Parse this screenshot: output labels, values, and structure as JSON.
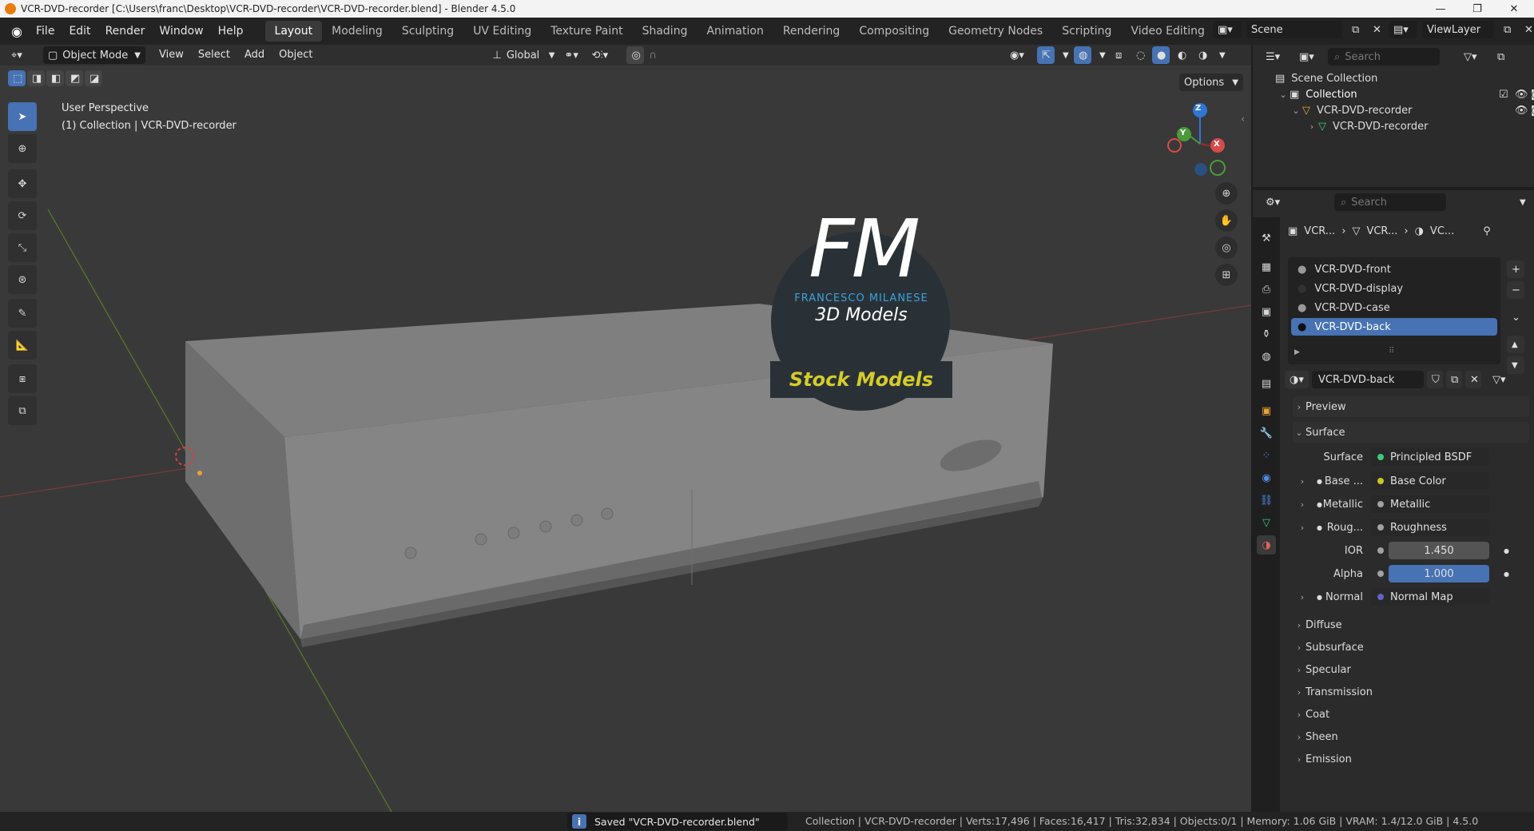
{
  "titlebar": {
    "title": "VCR-DVD-recorder [C:\\Users\\franc\\Desktop\\VCR-DVD-recorder\\VCR-DVD-recorder.blend] - Blender 4.5.0",
    "min": "—",
    "max": "❐",
    "close": "✕"
  },
  "menus": [
    "File",
    "Edit",
    "Render",
    "Window",
    "Help"
  ],
  "workspaces": [
    "Layout",
    "Modeling",
    "Sculpting",
    "UV Editing",
    "Texture Paint",
    "Shading",
    "Animation",
    "Rendering",
    "Compositing",
    "Geometry Nodes",
    "Scripting",
    "Video Editing"
  ],
  "workspace_add": "+",
  "scene": {
    "label": "Scene",
    "viewlayer": "ViewLayer"
  },
  "vp_header": {
    "mode": "Object Mode",
    "menus": [
      "View",
      "Select",
      "Add",
      "Object"
    ],
    "orientation": "Global",
    "options": "Options"
  },
  "viewport": {
    "perspective": "User Perspective",
    "collection_line": "(1) Collection | VCR-DVD-recorder"
  },
  "watermark": {
    "fm": "FM",
    "name": "FRANCESCO MILANESE",
    "sub": "3D Models",
    "banner": "Stock Models"
  },
  "gizmo": {
    "z": "Z",
    "y": "Y",
    "x": "X"
  },
  "outliner": {
    "search_placeholder": "Search",
    "scene_collection": "Scene Collection",
    "collection": "Collection",
    "object": "VCR-DVD-recorder",
    "mesh": "VCR-DVD-recorder"
  },
  "props": {
    "search_placeholder": "Search",
    "breadcrumb": [
      "VCR...",
      "VCR...",
      "VC..."
    ],
    "materials": [
      "VCR-DVD-front",
      "VCR-DVD-display",
      "VCR-DVD-case",
      "VCR-DVD-back"
    ],
    "selected_material": "VCR-DVD-back",
    "material_name": "VCR-DVD-back",
    "panels": {
      "preview": "Preview",
      "surface": "Surface"
    },
    "surface": {
      "label": "Surface",
      "value": "Principled BSDF"
    },
    "inputs": [
      {
        "label": "Base ...",
        "value": "Base Color",
        "dot": "#c7c729",
        "expand": true
      },
      {
        "label": "Metallic",
        "value": "Metallic",
        "dot": "#a1a1a1",
        "expand": true
      },
      {
        "label": "Roug...",
        "value": "Roughness",
        "dot": "#a1a1a1",
        "expand": true
      },
      {
        "label": "IOR",
        "value": "1.450",
        "dot": "#a1a1a1",
        "expand": false
      },
      {
        "label": "Alpha",
        "value": "1.000",
        "dot": "#a1a1a1",
        "expand": false
      },
      {
        "label": "Normal",
        "value": "Normal Map",
        "dot": "#6363c7",
        "expand": true
      }
    ],
    "subpanels": [
      "Diffuse",
      "Subsurface",
      "Specular",
      "Transmission",
      "Coat",
      "Sheen",
      "Emission"
    ]
  },
  "status": {
    "saved": "Saved \"VCR-DVD-recorder.blend\"",
    "stats": "Collection | VCR-DVD-recorder | Verts:17,496 | Faces:16,417 | Tris:32,834 | Objects:0/1 | Memory: 1.06 GiB | VRAM: 1.4/12.0 GiB | 4.5.0"
  },
  "colors": {
    "accent": "#4772b3",
    "orange": "#e87d0d",
    "bg": "#393939"
  }
}
